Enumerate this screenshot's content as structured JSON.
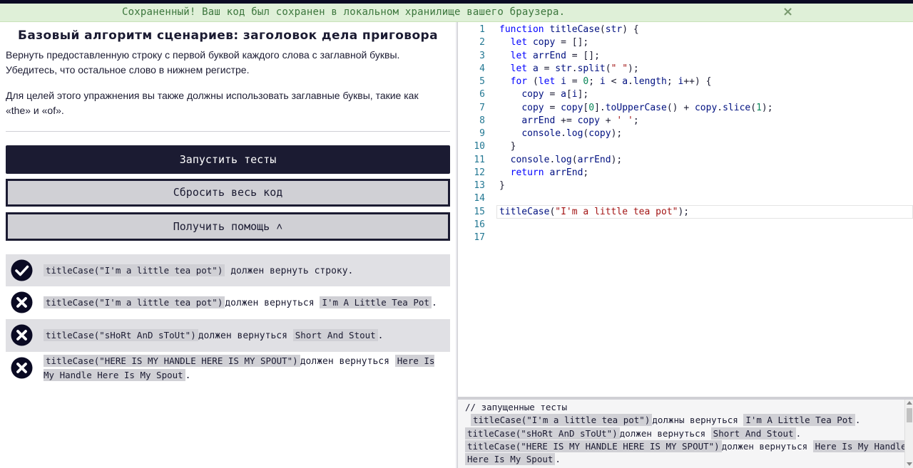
{
  "flash": {
    "message": "Сохраненный! Ваш код был сохранен в локальном хранилище вашего браузера.",
    "close": "×"
  },
  "challenge": {
    "title": "Базовый алгоритм сценариев: заголовок дела приговора",
    "description_1": "Вернуть предоставленную строку с первой буквой каждого слова с заглавной буквы. Убедитесь, что остальное слово в нижнем регистре.",
    "description_2": "Для целей этого упражнения вы также должны использовать заглавные буквы, такие как «the» и «of»."
  },
  "buttons": {
    "run": "Запустить тесты",
    "reset": "Сбросить весь код",
    "help": "Получить помощь ˄"
  },
  "tests": [
    {
      "status": "pass",
      "call": "titleCase(\"I'm a little tea pot\")",
      "text": "должен вернуть строку.",
      "expected": ""
    },
    {
      "status": "fail",
      "call": "titleCase(\"I'm a little tea pot\")",
      "text": "должен вернуться",
      "expected": "I'm A Little Tea Pot"
    },
    {
      "status": "fail",
      "call": "titleCase(\"sHoRt AnD sToUt\")",
      "text": "должен вернуться",
      "expected": "Short And Stout"
    },
    {
      "status": "fail",
      "call": "titleCase(\"HERE IS MY HANDLE HERE IS MY SPOUT\")",
      "text": "должен вернуться",
      "expected": "Here Is My Handle Here Is My Spout"
    }
  ],
  "editor": {
    "lines": [
      "function titleCase(str) {",
      "  let copy = [];",
      "  let arrEnd = [];",
      "  let a = str.split(\" \");",
      "  for (let i = 0; i < a.length; i++) {",
      "    copy = a[i];",
      "    copy = copy[0].toUpperCase() + copy.slice(1);",
      "    arrEnd += copy + ' ';",
      "    console.log(copy);",
      "  }",
      "  console.log(arrEnd);",
      "  return arrEnd;",
      "}",
      "",
      "titleCase(\"I'm a little tea pot\");",
      "",
      ""
    ],
    "active_line": 15
  },
  "console": {
    "header": "// запущенные тесты",
    "line1_call": "titleCase(\"I'm a little tea pot\")",
    "line1_text": "должны вернуться",
    "line1_expected": "I'm A Little Tea Pot",
    "line2_call": "titleCase(\"sHoRt AnD sToUt\")",
    "line2_text": "должен вернуться",
    "line2_expected": "Short And Stout",
    "line3_call": "titleCase(\"HERE IS MY HANDLE HERE IS MY SPOUT\")",
    "line3_text": "должен вернуться",
    "line3_expected_a": "Here Is My Handle",
    "line3_expected_b": "Here Is My Spout"
  },
  "colors": {
    "pass": "#0a0a23",
    "fail": "#0a0a23",
    "accent": "#1b1b32"
  }
}
